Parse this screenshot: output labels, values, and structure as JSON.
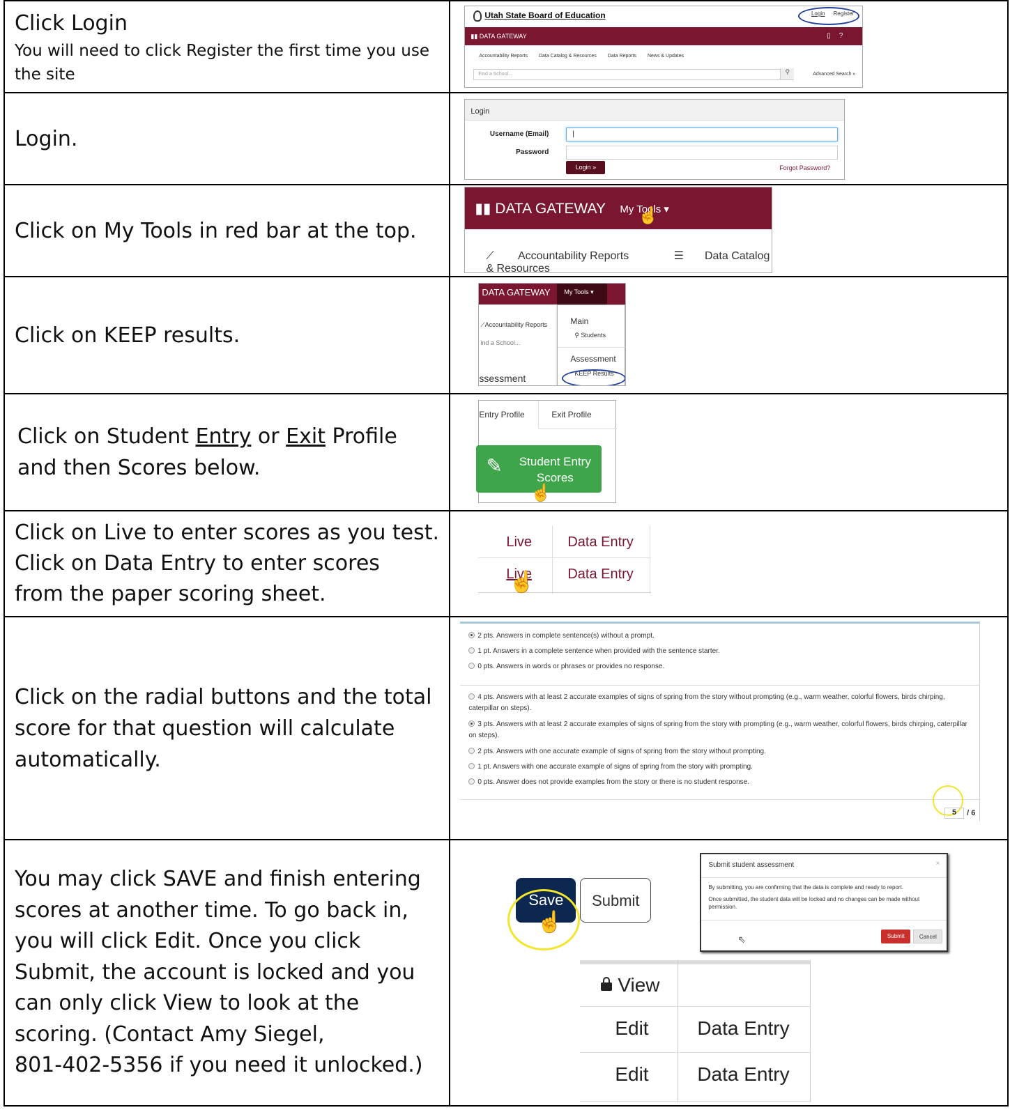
{
  "rows": [
    {
      "instruction": "Click Login",
      "note": "You will need to click Register the first time you use the site",
      "shot": {
        "org": "Utah State Board of Education",
        "login_link": "Login",
        "register_link": "Register",
        "bar_title": "DATA GATEWAY",
        "nav": [
          "Accountability Reports",
          "Data Catalog & Resources",
          "Data Reports",
          "News & Updates"
        ],
        "search_placeholder": "Find a School...",
        "advanced": "Advanced Search »"
      }
    },
    {
      "instruction": "Login.",
      "shot": {
        "panel_title": "Login",
        "username_label": "Username (Email)",
        "password_label": "Password",
        "username_value": "|",
        "login_button": "Login »",
        "forgot": "Forgot Password?"
      }
    },
    {
      "instruction": "Click on My Tools in red bar at the top.",
      "shot": {
        "bar_title": "DATA GATEWAY",
        "my_tools": "My Tools ▾",
        "nav": [
          "Accountability Reports",
          "Data Catalog & Resources"
        ]
      }
    },
    {
      "instruction": "Click on KEEP results.",
      "shot": {
        "bar_title": "DATA GATEWAY",
        "my_tools": "My Tools ▾",
        "acc": "Accountability Reports",
        "find": "ind a School...",
        "assess_left": "ssessment",
        "menu_main": "Main",
        "menu_students": "Students",
        "menu_assessment": "Assessment",
        "menu_keep": "KEEP Results"
      }
    },
    {
      "instruction_a": "Click on Student ",
      "instruction_entry": "Entry",
      "instruction_or": " or ",
      "instruction_exit": "Exit",
      "instruction_b": " Profile",
      "instruction_c": "and then Scores below.",
      "shot": {
        "tab_entry": "Entry Profile",
        "tab_exit": "Exit Profile",
        "button_line1": "Student Entry",
        "button_line2": "Scores"
      }
    },
    {
      "instruction_lines": [
        "Click on Live to enter scores as you test.",
        "Click on Data Entry to enter scores",
        "from the paper scoring sheet."
      ],
      "shot": {
        "live": "Live",
        "data_entry": "Data Entry"
      }
    },
    {
      "instruction_lines": [
        "Click on the radial buttons and the total",
        "score for that question will calculate",
        "automatically."
      ],
      "shot": {
        "group1": [
          {
            "text": "2 pts. Answers in complete sentence(s) without a prompt.",
            "selected": true
          },
          {
            "text": "1 pt. Answers in a complete sentence when provided with the sentence starter.",
            "selected": false
          },
          {
            "text": "0 pts. Answers in words or phrases or provides no response.",
            "selected": false
          }
        ],
        "group2": [
          {
            "text": "4 pts. Answers with at least 2 accurate examples of signs of spring from the story without prompting (e.g., warm weather, colorful flowers, birds chirping, caterpillar on steps).",
            "selected": false
          },
          {
            "text": "3 pts. Answers with at least 2 accurate examples of signs of spring from the story with prompting (e.g., warm weather, colorful flowers, birds chirping, caterpillar on steps).",
            "selected": true
          },
          {
            "text": "2 pts. Answers with one accurate example of signs of spring from the story without prompting.",
            "selected": false
          },
          {
            "text": "1 pt. Answers with one accurate example of signs of spring from the story with prompting.",
            "selected": false
          },
          {
            "text": "0 pts. Answer does not provide examples from the story or there is no student response.",
            "selected": false
          }
        ],
        "score_value": "5",
        "score_total": "/ 6"
      }
    },
    {
      "instruction_lines": [
        "You may click SAVE and finish entering",
        "scores at another time. To go back in,",
        "you will click Edit. Once you click",
        "Submit, the account is locked and you",
        "can only click View to look at the",
        "scoring. (Contact Amy Siegel,",
        "801-402-5356 if you need it unlocked.)"
      ],
      "shot": {
        "save": "Save",
        "submit": "Submit",
        "dialog_title": "Submit student assessment",
        "dialog_close": "×",
        "dialog_p1": "By submitting, you are confirming that the data is complete and ready to report.",
        "dialog_p2": "Once submitted, the student data will be locked and no changes can be made without permission.",
        "dialog_submit": "Submit",
        "dialog_cancel": "Cancel",
        "view": "View",
        "edit": "Edit",
        "data_entry": "Data Entry"
      }
    }
  ]
}
